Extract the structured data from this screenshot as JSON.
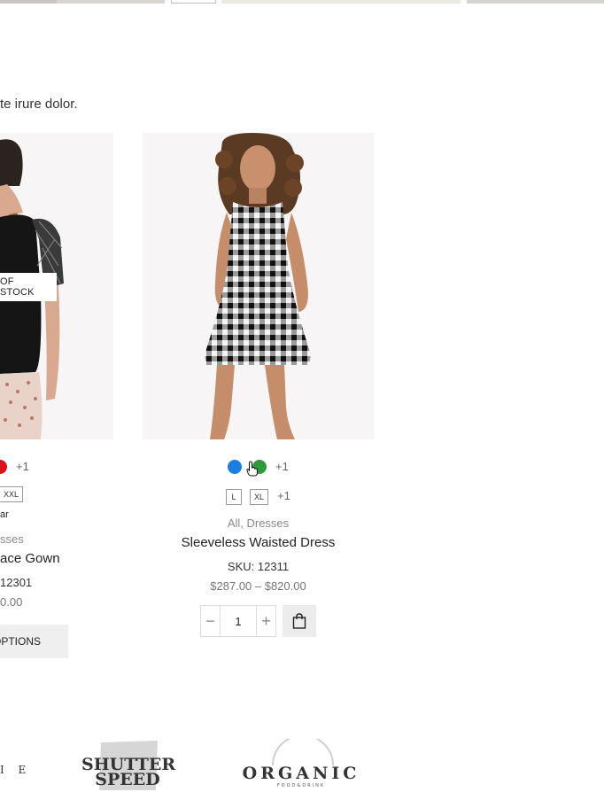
{
  "intro_text": "te irure dolor.",
  "left_product": {
    "badge": "OF STOCK",
    "swatch_more": "+1",
    "size": "XXL",
    "attribute_text": "ar",
    "category": "sses",
    "name": "ace Gown",
    "sku": "12301",
    "price": "0.00",
    "button": "OPTIONS",
    "colors": {
      "swatch": "#d9121b"
    }
  },
  "right_product": {
    "swatch_more": "+1",
    "sizes": [
      "L",
      "XL"
    ],
    "size_more": "+1",
    "category": "All, Dresses",
    "name": "Sleeveless Waisted Dress",
    "sku": "SKU: 12311",
    "price": "$287.00 – $820.00",
    "quantity": "1",
    "qty_minus": "−",
    "qty_plus": "+",
    "colors": {
      "swatch_blue": "#1a7fe0",
      "swatch_green": "#2e9a3a"
    },
    "cart_icon": "shopping-bag-icon"
  },
  "brands": {
    "left_partial": "I E",
    "shutter_line1": "SHUTTER",
    "shutter_line2": "SPEED",
    "organic": "ORGANIC",
    "organic_sub": "FOOD&DRINK"
  }
}
